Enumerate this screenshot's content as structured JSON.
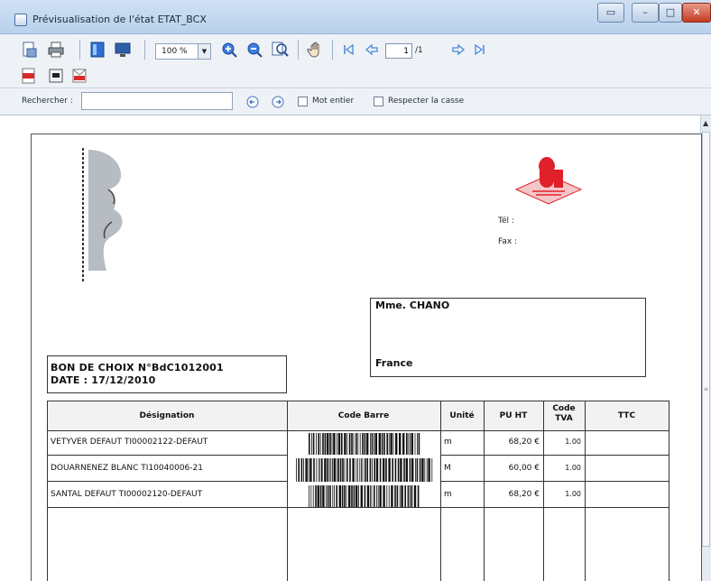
{
  "window": {
    "title": "Prévisualisation de l'état ETAT_BCX",
    "controls": {
      "minimize": "–",
      "maximize": "□",
      "close": "✕"
    }
  },
  "toolbar": {
    "zoom": "100 %",
    "page_current": "1",
    "page_total": "/1",
    "icons": [
      "page-setup-icon",
      "printer-icon",
      "single-page-icon",
      "monitor-icon",
      "zoom-in-icon",
      "zoom-out-icon",
      "zoom-fit-icon",
      "hand-tool-icon",
      "first-page-icon",
      "previous-page-icon",
      "next-page-icon",
      "last-page-icon"
    ],
    "export_icons": [
      "pdf-export-icon",
      "pdf-save-icon",
      "pdf-mail-icon"
    ]
  },
  "search": {
    "label": "Rechercher :",
    "value": "",
    "whole_word_label": "Mot entier",
    "match_case_label": "Respecter la casse"
  },
  "document": {
    "contact": {
      "tel_label": "Tél :",
      "fax_label": "Fax :"
    },
    "recipient": {
      "name": "Mme. CHANO",
      "country": "France"
    },
    "header": {
      "title": "BON DE CHOIX N°BdC1012001",
      "date": "DATE : 17/12/2010"
    },
    "table": {
      "columns": [
        "Désignation",
        "Code Barre",
        "Unité",
        "PU HT",
        "Code TVA",
        "TTC"
      ],
      "rows": [
        {
          "designation": "VETYVER DEFAUT TI00002122-DEFAUT",
          "unit": "m",
          "pu_ht": "68,20 €",
          "tva": "1.00",
          "ttc": ""
        },
        {
          "designation": "DOUARNENEZ BLANC TI10040006-21",
          "unit": "M",
          "pu_ht": "60,00 €",
          "tva": "1.00",
          "ttc": ""
        },
        {
          "designation": "SANTAL DEFAUT TI00002120-DEFAUT",
          "unit": "m",
          "pu_ht": "68,20 €",
          "tva": "1.00",
          "ttc": ""
        }
      ]
    },
    "colors": {
      "logo_red": "#e0202a"
    }
  }
}
